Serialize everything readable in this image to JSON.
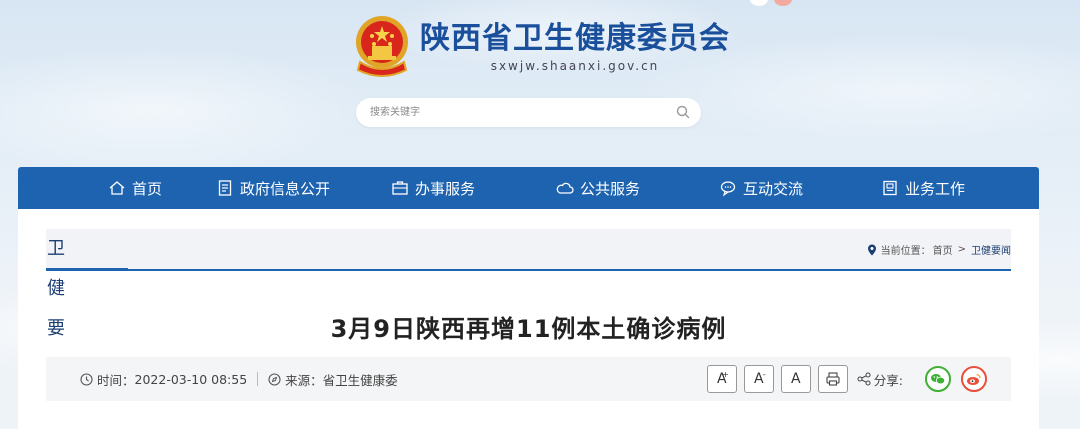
{
  "header": {
    "site_title": "陕西省卫生健康委员会",
    "site_url": "sxwjw.shaanxi.gov.cn"
  },
  "search": {
    "placeholder": "搜索关键字"
  },
  "nav": {
    "items": [
      {
        "label": "首页",
        "icon": "home-icon"
      },
      {
        "label": "政府信息公开",
        "icon": "document-icon"
      },
      {
        "label": "办事服务",
        "icon": "briefcase-icon"
      },
      {
        "label": "公共服务",
        "icon": "cloud-icon"
      },
      {
        "label": "互动交流",
        "icon": "chat-icon"
      },
      {
        "label": "业务工作",
        "icon": "badge-icon"
      }
    ]
  },
  "section": {
    "title": "卫健要闻",
    "location_label": "当前位置：",
    "crumbs": [
      "首页",
      "卫健要闻"
    ],
    "separator": ">"
  },
  "article": {
    "title": "3月9日陕西再增11例本土确诊病例",
    "time_label": "时间：",
    "time": "2022-03-10 08:55",
    "source_label": "来源：",
    "source": "省卫生健康委"
  },
  "tools": {
    "font_larger": "A",
    "font_larger_mark": "+",
    "font_smaller": "A",
    "font_smaller_mark": "-",
    "font_reset": "A",
    "share_label": "分享:"
  },
  "colors": {
    "nav_bg": "#1d63b0",
    "title_blue": "#1a4f9c",
    "wechat": "#3eb034",
    "weibo": "#e8503a"
  }
}
